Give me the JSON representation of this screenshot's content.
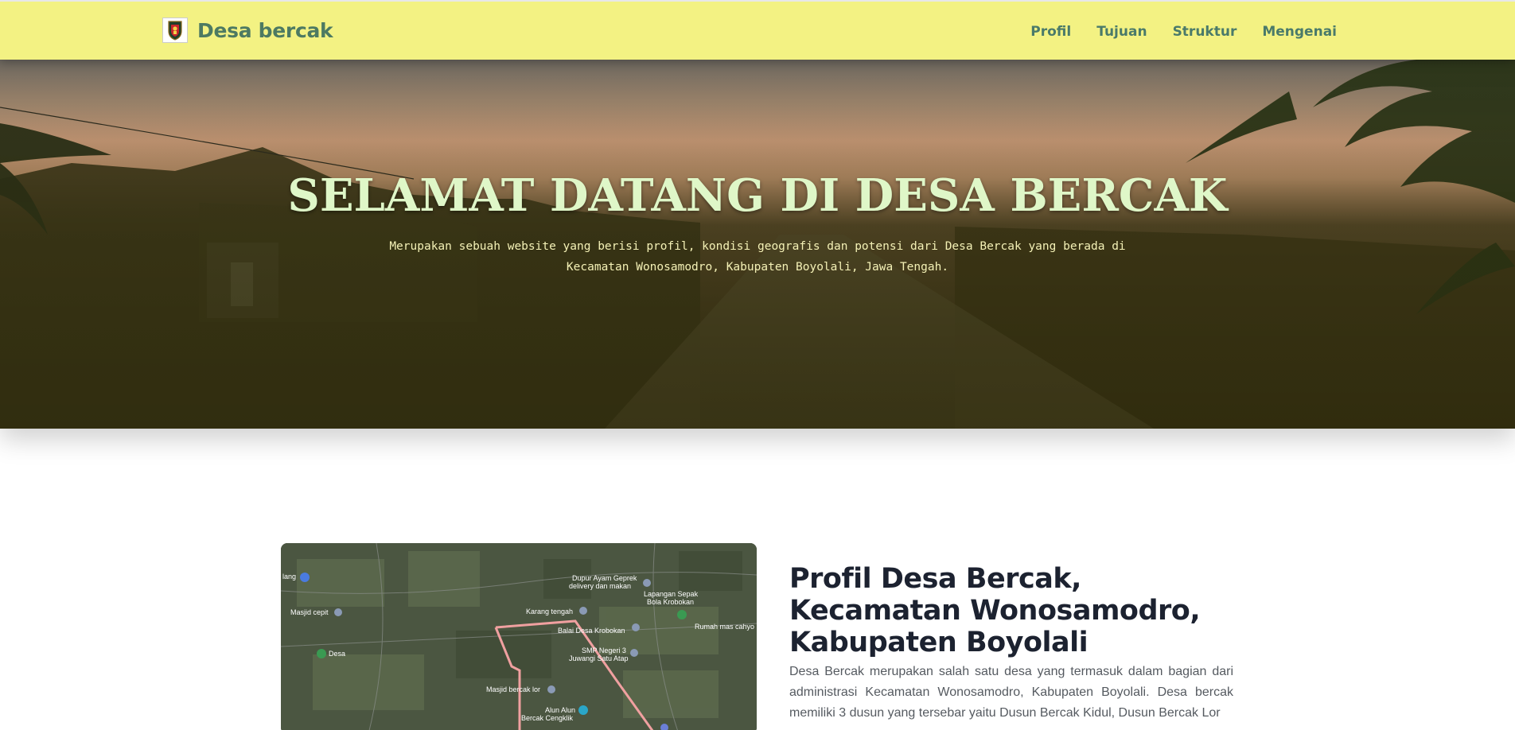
{
  "brand": {
    "name": "Desa bercak",
    "logo_icon": "village-emblem-icon"
  },
  "nav": {
    "items": [
      {
        "label": "Profil"
      },
      {
        "label": "Tujuan"
      },
      {
        "label": "Struktur"
      },
      {
        "label": "Mengenai"
      }
    ]
  },
  "hero": {
    "title": "SELAMAT DATANG DI DESA BERCAK",
    "subtitle": "Merupakan sebuah website yang berisi profil, kondisi geografis dan potensi dari Desa Bercak yang berada di Kecamatan Wonosamodro, Kabupaten Boyolali, Jawa Tengah."
  },
  "profile": {
    "title": "Profil Desa Bercak, Kecamatan Wonosamodro, Kabupaten Boyolali",
    "text": "Desa Bercak merupakan salah satu desa yang termasuk dalam bagian dari administrasi Kecamatan Wonosamodro, Kabupaten Boyolali. Desa bercak memiliki 3 dusun yang tersebar yaitu Dusun Bercak Kidul, Dusun Bercak Lor"
  },
  "map": {
    "labels": [
      {
        "text": "lang"
      },
      {
        "text": "Masjid cepit"
      },
      {
        "text": "Desa"
      },
      {
        "text": "Dupur Ayam Geprek"
      },
      {
        "text": "delivery dan makan"
      },
      {
        "text": "Lapangan Sepak"
      },
      {
        "text": "Bola Krobokan"
      },
      {
        "text": "Karang tengah"
      },
      {
        "text": "Balai Desa Krobokan"
      },
      {
        "text": "Rumah mas cahyo"
      },
      {
        "text": "SMP Negeri 3"
      },
      {
        "text": "Juwangi Satu Atap"
      },
      {
        "text": "Masjid bercak lor"
      },
      {
        "text": "Alun Alun"
      },
      {
        "text": "Bercak Cengklik"
      }
    ]
  },
  "colors": {
    "navbar_bg": "#f3f283",
    "brand_text": "#4d7a62",
    "hero_title": "#dff7c8",
    "hero_subtitle": "#f4f1b6",
    "route": "#f0a0a0"
  }
}
